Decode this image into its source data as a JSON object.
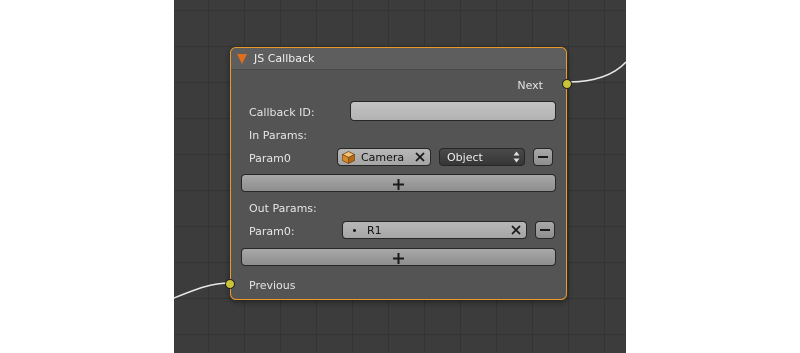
{
  "node": {
    "title": "JS Callback",
    "output_socket_label": "Next",
    "input_socket_label": "Previous",
    "callback_id": {
      "label": "Callback ID:",
      "value": "",
      "placeholder": ""
    },
    "in_params": {
      "heading": "In Params:",
      "rows": [
        {
          "label": "Param0",
          "object_value": "Camera",
          "object_icon": "cube-icon",
          "type_value": "Object"
        }
      ]
    },
    "out_params": {
      "heading": "Out Params:",
      "rows": [
        {
          "label": "Param0:",
          "value": "R1"
        }
      ]
    },
    "add_icon": "plus-icon",
    "remove_icon": "minus-icon",
    "clear_icon": "x-icon"
  },
  "colors": {
    "node_border": "#e89a2d",
    "socket": "#c9c33a",
    "collapse_arrow": "#e06f1c",
    "editor_background": "#3c3c3c"
  }
}
